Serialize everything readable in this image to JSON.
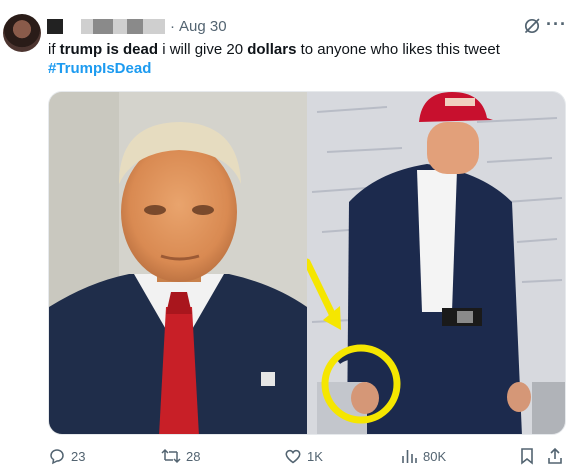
{
  "header": {
    "date": "Aug 30",
    "separator": "·"
  },
  "tweet": {
    "parts": [
      {
        "text": "if ",
        "bold": false
      },
      {
        "text": "trump is dead",
        "bold": true
      },
      {
        "text": " i will give 20 ",
        "bold": false
      },
      {
        "text": "dollars",
        "bold": true
      },
      {
        "text": " to anyone who likes this tweet",
        "bold": false
      }
    ],
    "hashtag": "#TrumpIsDead"
  },
  "media": {
    "left_photo": "portrait",
    "right_photo": "standing figure with highlighted hand"
  },
  "actions": {
    "replies": "23",
    "reposts": "28",
    "likes": "1K",
    "views": "80K"
  },
  "icons": [
    "grok-icon",
    "more-icon",
    "reply-icon",
    "repost-icon",
    "like-icon",
    "views-icon",
    "bookmark-icon",
    "share-icon"
  ],
  "colors": {
    "accent": "#1d9bf0",
    "muted": "#536471",
    "highlight": "#f5e600",
    "cap_red": "#c8102e"
  }
}
